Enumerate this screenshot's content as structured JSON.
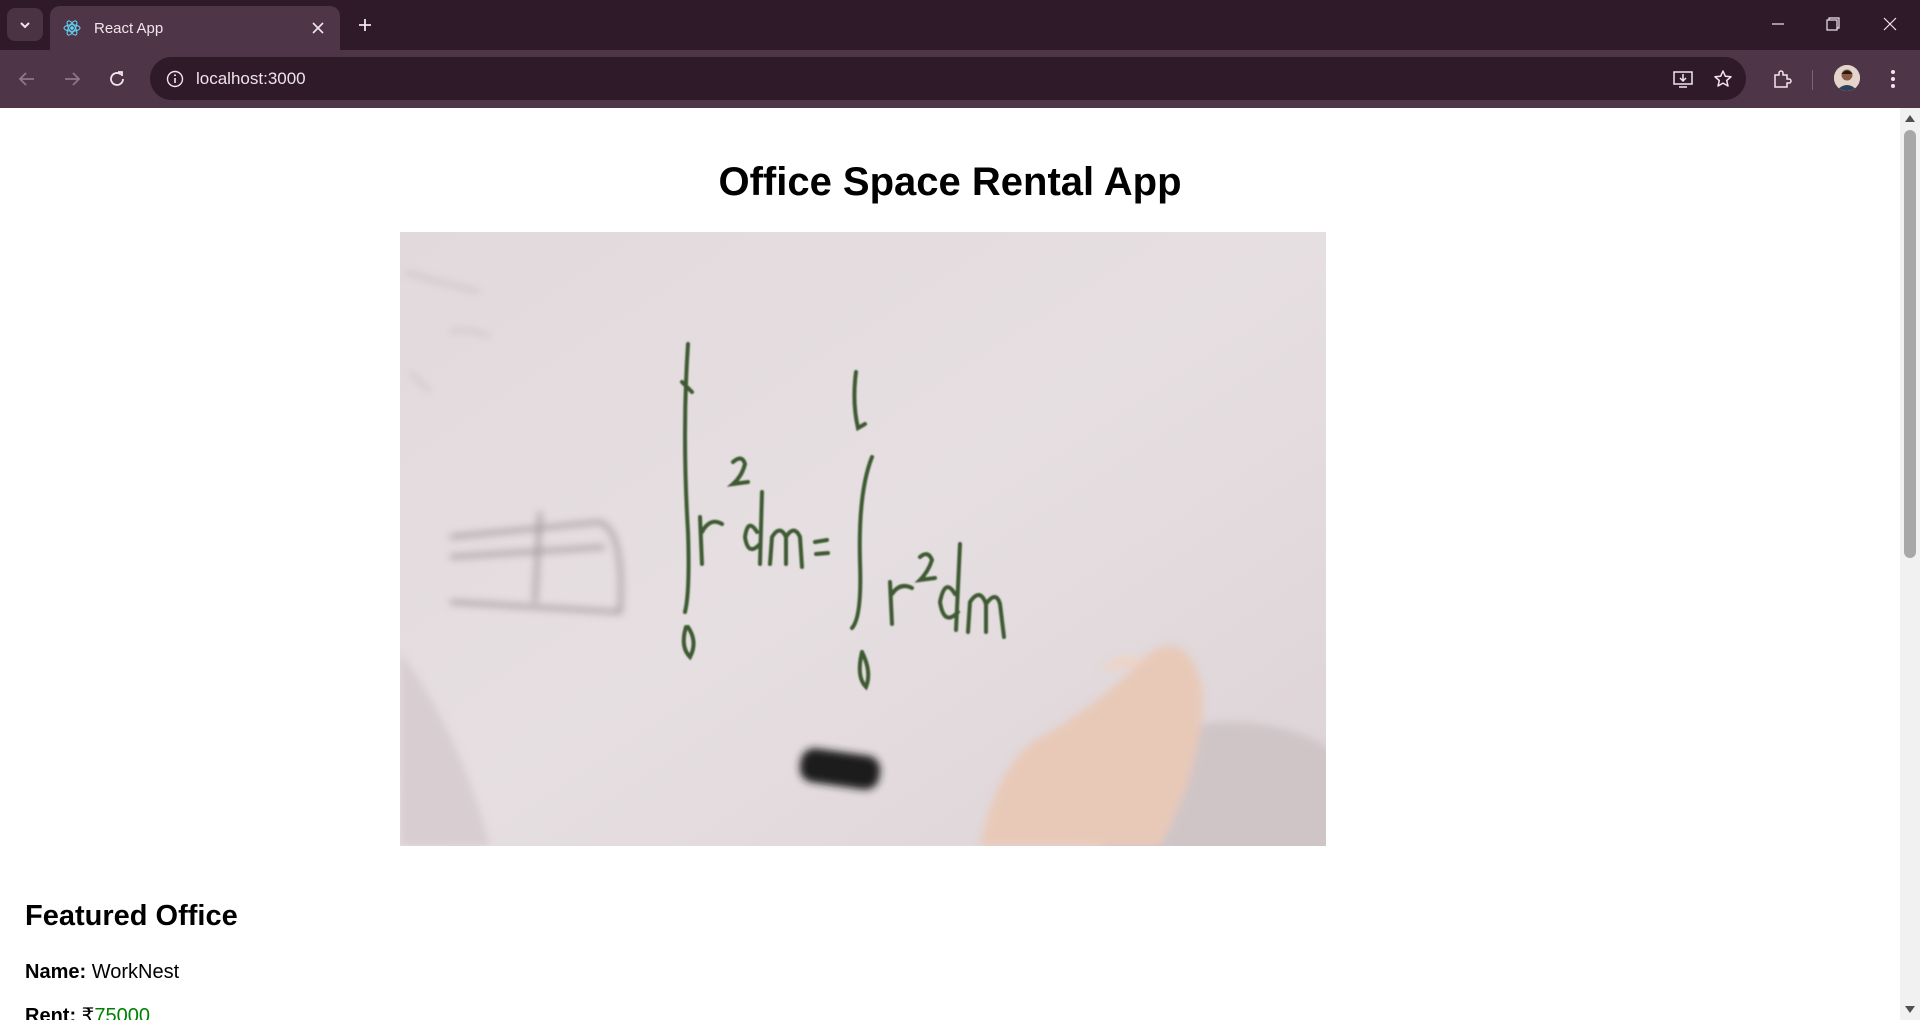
{
  "browser": {
    "tab_title": "React App",
    "url": "localhost:3000"
  },
  "page": {
    "title": "Office Space Rental App",
    "hero_image_alt": "Whiteboard with handwritten equation",
    "hero_image_text": {
      "limit_top": "L",
      "lhs": "r²dm =",
      "rhs": "r²dm",
      "limit_bottom": "0"
    },
    "featured_heading": "Featured Office",
    "name_label": "Name:",
    "name_value": "WorkNest",
    "rent_label": "Rent:",
    "rent_currency": "₹",
    "rent_value": "75000"
  },
  "colors": {
    "tabbar_bg": "#2f1a29",
    "toolbar_bg": "#4e3547",
    "rent_value_color": "#008000"
  },
  "icons": [
    "tab-search-icon",
    "react-logo-icon",
    "close-icon",
    "plus-icon",
    "minimize-icon",
    "restore-icon",
    "window-close-icon",
    "back-icon",
    "forward-icon",
    "reload-icon",
    "info-icon",
    "install-icon",
    "star-icon",
    "extensions-icon",
    "avatar",
    "more-icon"
  ]
}
